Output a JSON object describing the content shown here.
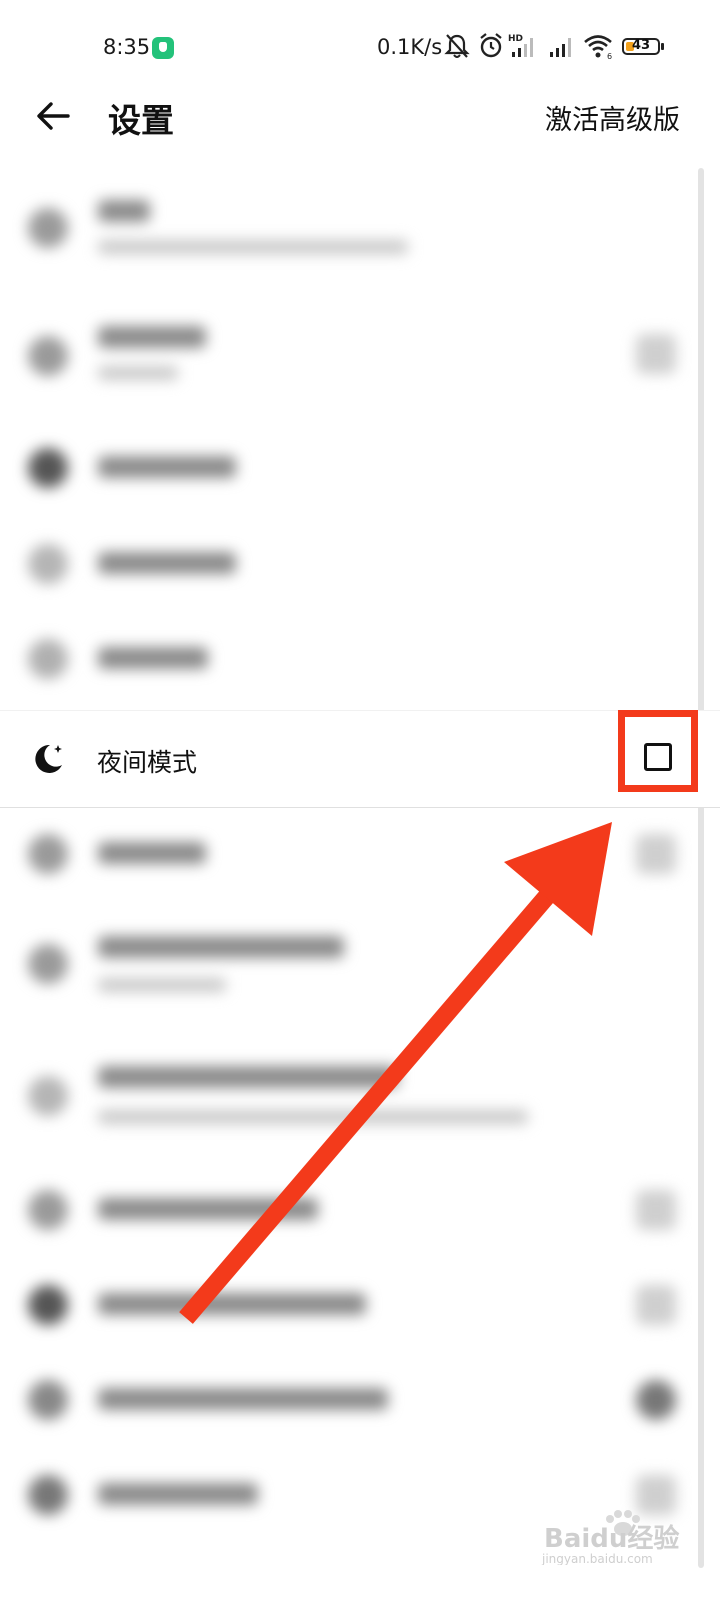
{
  "status_bar": {
    "time": "8:35",
    "network_speed": "0.1K/s",
    "battery_level": "43",
    "icons": [
      "vpn-shield-icon",
      "mute-bell-icon",
      "alarm-icon",
      "hd-signal-icon",
      "signal-icon",
      "wifi-icon",
      "battery-icon"
    ]
  },
  "header": {
    "back_icon": "arrow-left-icon",
    "title": "设置",
    "upgrade_label": "激活高级版"
  },
  "settings": {
    "night_mode": {
      "icon": "moon-icon",
      "label": "夜间模式",
      "checked": false
    }
  },
  "colors": {
    "highlight": "#f33a1b",
    "vpn_badge": "#23c27a",
    "battery": "#f3a11b"
  },
  "watermark": {
    "text": "Baidu经验",
    "subtext": "jingyan.baidu.com"
  }
}
